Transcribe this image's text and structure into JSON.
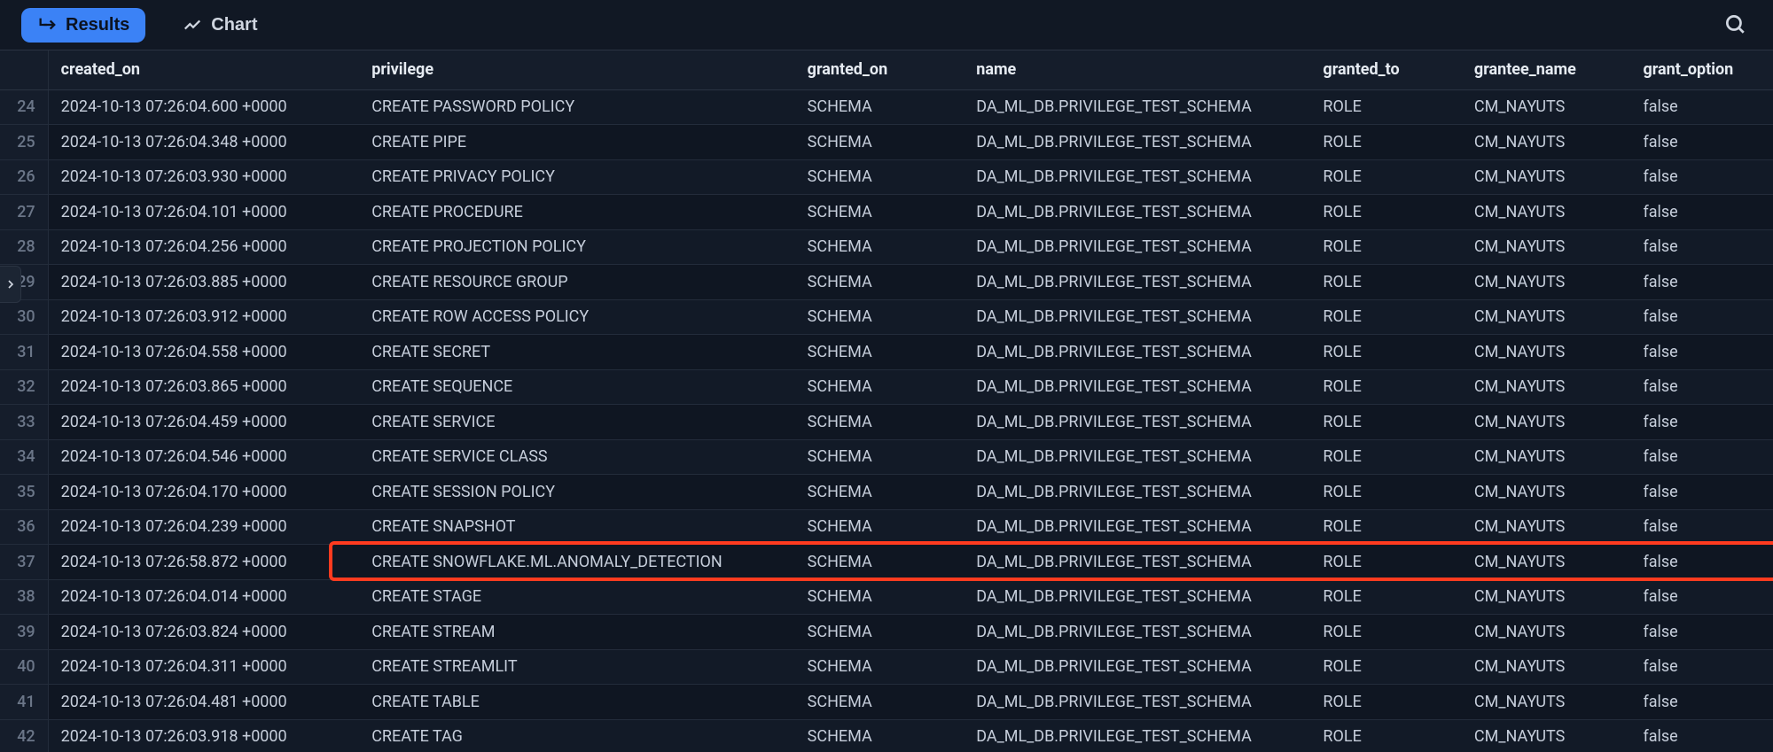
{
  "toolbar": {
    "results_label": "Results",
    "chart_label": "Chart"
  },
  "columns": {
    "created_on": "created_on",
    "privilege": "privilege",
    "granted_on": "granted_on",
    "name": "name",
    "granted_to": "granted_to",
    "grantee_name": "grantee_name",
    "grant_option": "grant_option"
  },
  "common": {
    "granted_on": "SCHEMA",
    "name": "DA_ML_DB.PRIVILEGE_TEST_SCHEMA",
    "granted_to": "ROLE",
    "grantee_name": "CM_NAYUTS",
    "grant_option": "false"
  },
  "rows": [
    {
      "n": "24",
      "created_on": "2024-10-13 07:26:04.600 +0000",
      "privilege": "CREATE PASSWORD POLICY"
    },
    {
      "n": "25",
      "created_on": "2024-10-13 07:26:04.348 +0000",
      "privilege": "CREATE PIPE"
    },
    {
      "n": "26",
      "created_on": "2024-10-13 07:26:03.930 +0000",
      "privilege": "CREATE PRIVACY POLICY"
    },
    {
      "n": "27",
      "created_on": "2024-10-13 07:26:04.101 +0000",
      "privilege": "CREATE PROCEDURE"
    },
    {
      "n": "28",
      "created_on": "2024-10-13 07:26:04.256 +0000",
      "privilege": "CREATE PROJECTION POLICY"
    },
    {
      "n": "29",
      "created_on": "2024-10-13 07:26:03.885 +0000",
      "privilege": "CREATE RESOURCE GROUP"
    },
    {
      "n": "30",
      "created_on": "2024-10-13 07:26:03.912 +0000",
      "privilege": "CREATE ROW ACCESS POLICY"
    },
    {
      "n": "31",
      "created_on": "2024-10-13 07:26:04.558 +0000",
      "privilege": "CREATE SECRET"
    },
    {
      "n": "32",
      "created_on": "2024-10-13 07:26:03.865 +0000",
      "privilege": "CREATE SEQUENCE"
    },
    {
      "n": "33",
      "created_on": "2024-10-13 07:26:04.459 +0000",
      "privilege": "CREATE SERVICE"
    },
    {
      "n": "34",
      "created_on": "2024-10-13 07:26:04.546 +0000",
      "privilege": "CREATE SERVICE CLASS"
    },
    {
      "n": "35",
      "created_on": "2024-10-13 07:26:04.170 +0000",
      "privilege": "CREATE SESSION POLICY"
    },
    {
      "n": "36",
      "created_on": "2024-10-13 07:26:04.239 +0000",
      "privilege": "CREATE SNAPSHOT"
    },
    {
      "n": "37",
      "created_on": "2024-10-13 07:26:58.872 +0000",
      "privilege": "CREATE SNOWFLAKE.ML.ANOMALY_DETECTION",
      "highlight": true
    },
    {
      "n": "38",
      "created_on": "2024-10-13 07:26:04.014 +0000",
      "privilege": "CREATE STAGE"
    },
    {
      "n": "39",
      "created_on": "2024-10-13 07:26:03.824 +0000",
      "privilege": "CREATE STREAM"
    },
    {
      "n": "40",
      "created_on": "2024-10-13 07:26:04.311 +0000",
      "privilege": "CREATE STREAMLIT"
    },
    {
      "n": "41",
      "created_on": "2024-10-13 07:26:04.481 +0000",
      "privilege": "CREATE TABLE"
    },
    {
      "n": "42",
      "created_on": "2024-10-13 07:26:03.918 +0000",
      "privilege": "CREATE TAG"
    }
  ]
}
